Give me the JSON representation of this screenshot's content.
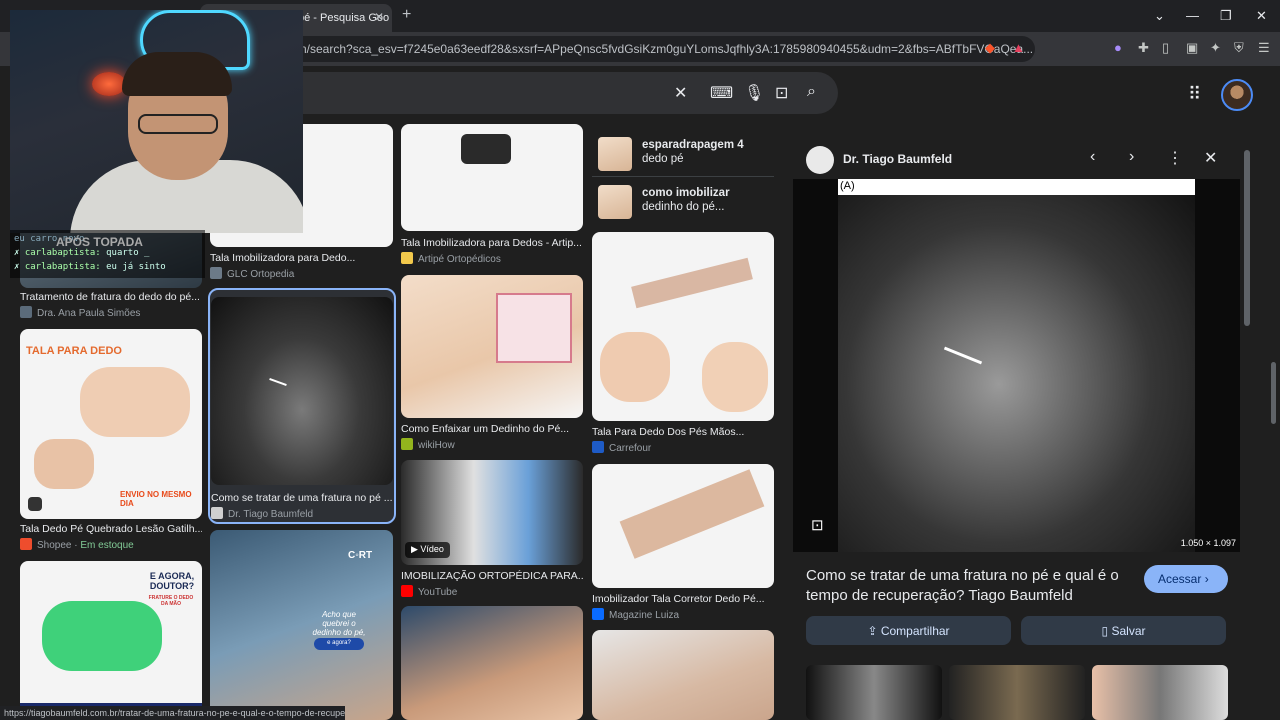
{
  "browser": {
    "tab_title": "pé - Pesquisa Goo",
    "url": "n/search?sca_esv=f7245e0a63eedf28&sxsrf=APpeQnsc5fvdGsiKzm0guYLomsJqfhly3A:1785980940455&udm=2&fbs=ABfTbFVGaQea...",
    "status_url": "https://tiagobaumfeld.com.br/tratar-de-uma-fratura-no-pe-e-qual-e-o-tempo-de-recuperacao/"
  },
  "webcam": {
    "chat_title": "APÓS TOPADA",
    "chat_top": "eu carro novo",
    "chat_lines": [
      {
        "name": "carlabaptista:",
        "text": "quarto _"
      },
      {
        "name": "carlabaptista:",
        "text": "eu já sinto"
      }
    ]
  },
  "grid": {
    "col1": [
      {
        "caption": "Tratamento de fratura do dedo do pé...",
        "source": "Dra. Ana Paula Simões"
      },
      {
        "caption": "Tala Dedo Pé Quebrado Lesão Gatilh...",
        "source": "Shopee",
        "stock": "Em estoque",
        "overlay_title": "TALA PARA DEDO",
        "overlay_sub": "ENVIO NO MESMO DIA"
      },
      {
        "overlay": "E AGORA, DOUTOR?",
        "overlay_sub": "FRATURE O DEDO DA MÃO"
      }
    ],
    "col2": [
      {
        "caption": "Tala Imobilizadora para Dedo...",
        "source": "GLC Ortopedia"
      },
      {
        "caption": "Como se tratar de uma fratura no pé ...",
        "source": "Dr. Tiago Baumfeld"
      },
      {
        "overlay_brand": "C◦RT",
        "overlay_text": "Acho que quebrei o dedinho do pé,",
        "overlay_pill": "e agora?"
      }
    ],
    "col3": [
      {
        "caption": "Tala Imobilizadora para Dedos - Artip...",
        "source": "Artipé Ortopédicos"
      },
      {
        "caption": "Como Enfaixar um Dedinho do Pé...",
        "source": "wikiHow"
      },
      {
        "caption": "IMOBILIZAÇÃO ORTOPÉDICA PARA...",
        "source": "YouTube",
        "badge": "Vídeo"
      }
    ],
    "col4": [
      {
        "caption": "Tala Para Dedo Dos Pés Mãos...",
        "source": "Carrefour"
      },
      {
        "caption": "Imobilizador Tala Corretor Dedo Pé...",
        "source": "Magazine Luiza"
      }
    ],
    "related": [
      {
        "bold": "esparadrapagem 4",
        "rest": "dedo pé"
      },
      {
        "bold": "como imobilizar",
        "rest": "dedinho do pé..."
      }
    ]
  },
  "panel": {
    "source": "Dr. Tiago Baumfeld",
    "image_label": "(A)",
    "dimensions": "1.050 × 1.097",
    "title": "Como se tratar de uma fratura no pé e qual é o tempo de recuperação? Tiago Baumfeld",
    "visit_label": "Acessar",
    "share_label": "Compartilhar",
    "save_label": "Salvar"
  }
}
